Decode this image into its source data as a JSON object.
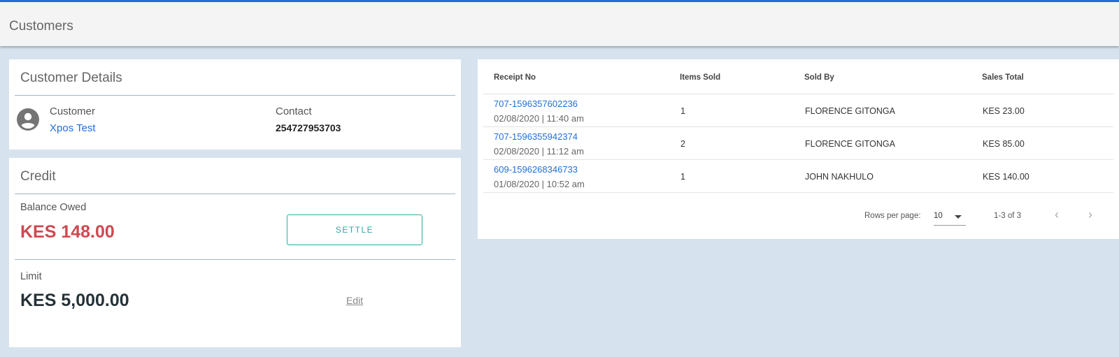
{
  "header": {
    "title": "Customers"
  },
  "customer_details": {
    "title": "Customer Details",
    "customer_label": "Customer",
    "customer_name": "Xpos Test",
    "contact_label": "Contact",
    "contact_value": "254727953703"
  },
  "credit": {
    "title": "Credit",
    "balance_label": "Balance Owed",
    "balance_value": "KES 148.00",
    "settle_label": "SETTLE",
    "limit_label": "Limit",
    "limit_value": "KES 5,000.00",
    "edit_label": "Edit"
  },
  "receipts": {
    "columns": [
      "Receipt No",
      "Items Sold",
      "Sold By",
      "Sales Total"
    ],
    "rows": [
      {
        "receipt_no": "707-1596357602236",
        "datetime": "02/08/2020 | 11:40 am",
        "items": "1",
        "sold_by": "FLORENCE GITONGA",
        "total": "KES 23.00"
      },
      {
        "receipt_no": "707-1596355942374",
        "datetime": "02/08/2020 | 11:12 am",
        "items": "2",
        "sold_by": "FLORENCE GITONGA",
        "total": "KES 85.00"
      },
      {
        "receipt_no": "609-1596268346733",
        "datetime": "01/08/2020 | 10:52 am",
        "items": "1",
        "sold_by": "JOHN NAKHULO",
        "total": "KES 140.00"
      }
    ],
    "pagination": {
      "rows_per_page_label": "Rows per page:",
      "rows_per_page": "10",
      "range": "1-3 of 3",
      "prev_icon": "chevron-left-icon",
      "next_icon": "chevron-right-icon"
    }
  },
  "colors": {
    "accent": "#1e6fd9",
    "balance": "#d0484f",
    "settle": "#2aaea0",
    "background": "#d6e3ef"
  }
}
